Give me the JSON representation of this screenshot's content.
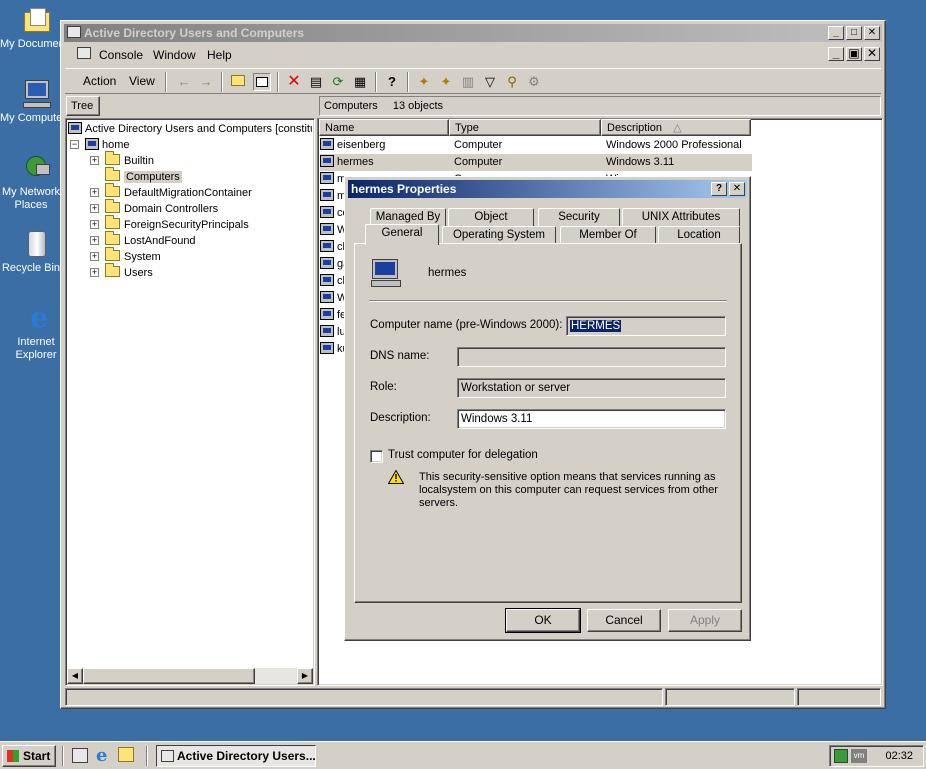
{
  "desktop": {
    "icons": [
      {
        "label": "My Documents"
      },
      {
        "label": "My Computer"
      },
      {
        "label": "My Network Places"
      },
      {
        "label": "Recycle Bin"
      },
      {
        "label": "Internet Explorer"
      }
    ]
  },
  "main_window": {
    "title": "Active Directory Users and Computers",
    "menu": [
      "Console",
      "Window",
      "Help"
    ],
    "action_menu": [
      "Action",
      "View"
    ],
    "tree_tab": "Tree",
    "tree": {
      "root": "Active Directory Users and Computers [constitu",
      "domain": "home",
      "items": [
        "Builtin",
        "Computers",
        "DefaultMigrationContainer",
        "Domain Controllers",
        "ForeignSecurityPrincipals",
        "LostAndFound",
        "System",
        "Users"
      ]
    },
    "right_header": {
      "container": "Computers",
      "count": "13 objects"
    },
    "columns": [
      "Name",
      "Type",
      "Description"
    ],
    "rows": [
      {
        "name": "eisenberg",
        "type": "Computer",
        "description": "Windows 2000 Professional"
      },
      {
        "name": "hermes",
        "type": "Computer",
        "description": "Windows 3.11"
      },
      {
        "name": "m",
        "type": "",
        "description": ""
      },
      {
        "name": "m",
        "type": "",
        "description": ""
      },
      {
        "name": "cc",
        "type": "",
        "description": ""
      },
      {
        "name": "W",
        "type": "",
        "description": ""
      },
      {
        "name": "ch",
        "type": "",
        "description": ""
      },
      {
        "name": "ga",
        "type": "",
        "description": ""
      },
      {
        "name": "ch",
        "type": "",
        "description": ""
      },
      {
        "name": "W",
        "type": "",
        "description": ""
      },
      {
        "name": "fe",
        "type": "",
        "description": ""
      },
      {
        "name": "lu",
        "type": "",
        "description": ""
      },
      {
        "name": "ku",
        "type": "",
        "description": ""
      }
    ],
    "partial_row_3": {
      "name": "m",
      "type": "C",
      "description": "Wi"
    }
  },
  "dialog": {
    "title": "hermes Properties",
    "tabs_row1": [
      "Managed By",
      "Object",
      "Security",
      "UNIX Attributes"
    ],
    "tabs_row2": [
      "General",
      "Operating System",
      "Member Of",
      "Location"
    ],
    "object_name": "hermes",
    "fields": {
      "computer_name_label": "Computer name (pre-Windows 2000):",
      "computer_name_value": "HERMES",
      "dns_label": "DNS name:",
      "dns_value": "",
      "role_label": "Role:",
      "role_value": "Workstation or server",
      "description_label": "Description:",
      "description_value": "Windows 3.11"
    },
    "trust_label": "Trust computer for delegation",
    "warning_text": "This security-sensitive option means that services running as localsystem on this computer can request services from other servers.",
    "buttons": {
      "ok": "OK",
      "cancel": "Cancel",
      "apply": "Apply"
    }
  },
  "taskbar": {
    "start": "Start",
    "task": "Active Directory Users...",
    "clock": "02:32"
  }
}
